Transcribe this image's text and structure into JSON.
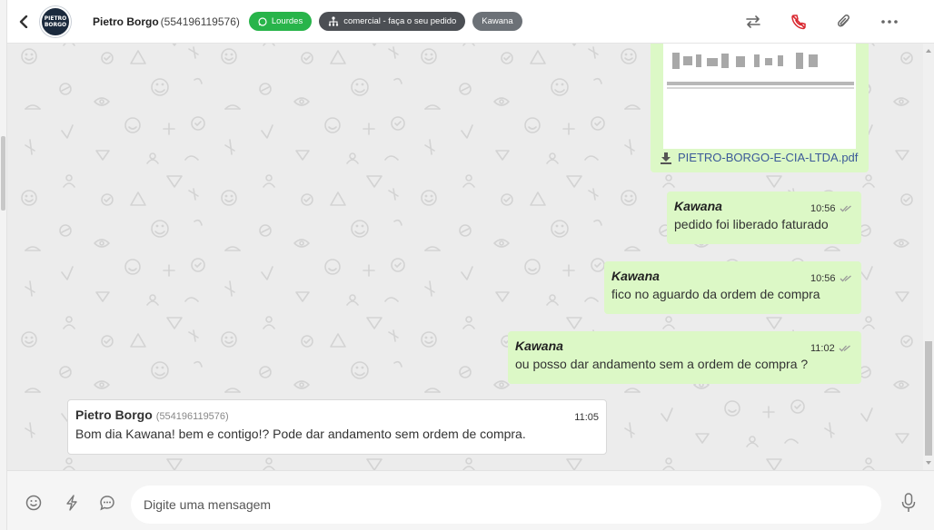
{
  "header": {
    "contact_name": "Pietro Borgo",
    "contact_phone": "(554196119576)",
    "avatar_text_1": "PIETRO",
    "avatar_text_2": "BORGO",
    "tags": [
      {
        "label": "Lourdes",
        "icon": "whatsapp-icon",
        "color": "#28b44a"
      },
      {
        "label": "comercial - faça o seu pedido",
        "icon": "sitemap-icon",
        "color": "#4c4f54"
      },
      {
        "label": "Kawana",
        "color": "#6c7177"
      }
    ],
    "actions": [
      "transfer-icon",
      "end-call-icon",
      "attachment-icon",
      "more-options-icon"
    ]
  },
  "messages": {
    "file": {
      "filename": "PIETRO-BORGO-E-CIA-LTDA.pdf"
    },
    "outgoing": [
      {
        "sender": "Kawana",
        "time": "10:56",
        "text": "pedido foi liberado faturado"
      },
      {
        "sender": "Kawana",
        "time": "10:56",
        "text": "fico no aguardo da ordem de compra"
      },
      {
        "sender": "Kawana",
        "time": "11:02",
        "text": "ou posso dar andamento sem a ordem de compra ?"
      }
    ],
    "incoming": {
      "sender": "Pietro Borgo",
      "phone": "(554196119576)",
      "time": "11:05",
      "text": "Bom dia Kawana! bem e contigo!? Pode dar andamento sem ordem de compra."
    }
  },
  "footer": {
    "placeholder": "Digite uma mensagem",
    "icons": [
      "emoji-icon",
      "quick-reply-icon",
      "chat-bubble-icon",
      "microphone-icon"
    ]
  },
  "colors": {
    "outgoing_bubble": "#dcf8c6",
    "incoming_bubble": "#ffffff",
    "chat_background": "#ececec",
    "tag_green": "#28b44a",
    "end_call_red": "#d9262e",
    "link_blue": "#3b5998"
  }
}
